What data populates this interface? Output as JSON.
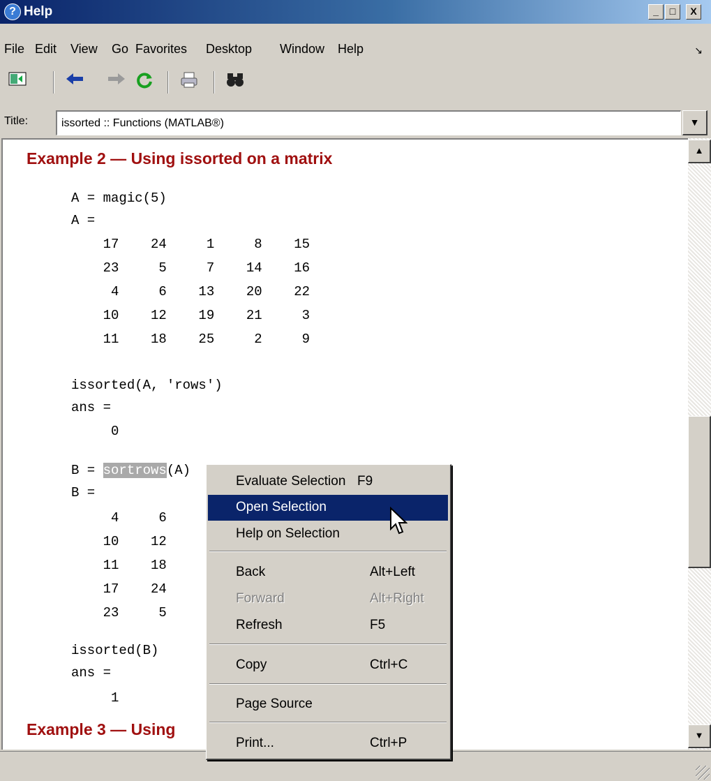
{
  "window": {
    "title": "Help",
    "controls": {
      "minimize": "_",
      "maximize": "□",
      "close": "X"
    }
  },
  "menubar": {
    "items": [
      "File",
      "Edit",
      "View",
      "Go",
      "Favorites",
      "Desktop",
      "Window",
      "Help"
    ],
    "undock_icon": "undock-arrow-icon"
  },
  "toolbar": {
    "icons": [
      "hide-navigator-icon",
      "back-arrow-icon",
      "forward-arrow-icon",
      "refresh-icon",
      "print-icon",
      "find-binoculars-icon"
    ]
  },
  "title_field": {
    "label": "Title:",
    "value": "issorted :: Functions (MATLAB®)"
  },
  "content": {
    "heading1": "Example 2 — Using issorted on a matrix",
    "heading2_visible": "Example 3 — Using",
    "code_lines": [
      "A = magic(5)",
      "A =",
      "    17    24     1     8    15",
      "    23     5     7    14    16",
      "     4     6    13    20    22",
      "    10    12    19    21     3",
      "    11    18    25     2     9",
      "",
      "issorted(A, 'rows')",
      "ans =",
      "     0",
      ""
    ],
    "line_b_prefix": "B = ",
    "line_b_selected": "sortrows",
    "line_b_suffix": "(A)",
    "code_lines_after": [
      "B =",
      "     4     6",
      "    10    12",
      "    11    18",
      "    17    24",
      "    23     5",
      "",
      "issorted(B)",
      "ans =",
      "     1"
    ]
  },
  "context_menu": {
    "items": [
      {
        "label": "Evaluate Selection",
        "shortcut": "F9"
      },
      {
        "label": "Open Selection",
        "shortcut": ""
      },
      {
        "label": "Help on Selection",
        "shortcut": ""
      },
      {
        "label": "Back",
        "shortcut": "Alt+Left"
      },
      {
        "label": "Forward",
        "shortcut": "Alt+Right"
      },
      {
        "label": "Refresh",
        "shortcut": "F5"
      },
      {
        "label": "Copy",
        "shortcut": "Ctrl+C"
      },
      {
        "label": "Page Source",
        "shortcut": ""
      },
      {
        "label": "Print...",
        "shortcut": "Ctrl+P"
      }
    ],
    "highlighted": "Open Selection",
    "disabled": [
      "Forward"
    ],
    "highlight_color": "#0a246a"
  },
  "colors": {
    "heading": "#a01010",
    "titlebar_start": "#0a246a",
    "chrome": "#d4d0c8"
  }
}
